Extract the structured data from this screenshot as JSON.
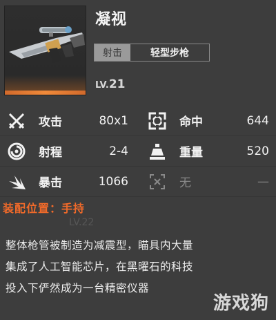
{
  "weapon": {
    "name": "凝视",
    "category": "射击",
    "subtype": "轻型步枪",
    "level_prefix": "LV.",
    "level": "21"
  },
  "stats": [
    {
      "icon": "crossed-swords-icon",
      "label": "攻击",
      "value": "80x1"
    },
    {
      "icon": "target-reticle-icon",
      "label": "命中",
      "value": "644"
    },
    {
      "icon": "range-spiral-icon",
      "label": "射程",
      "value": "2-4"
    },
    {
      "icon": "weight-icon",
      "label": "重量",
      "value": "520"
    },
    {
      "icon": "critical-burst-icon",
      "label": "暴击",
      "value": "1066"
    },
    {
      "icon": "none-icon",
      "label": "无",
      "value": "—"
    }
  ],
  "assembly": "装配位置：手持",
  "ghost_level": "LV.22",
  "description_lines": [
    "整体枪管被制造为减震型，瞄具内大量",
    "集成了人工智能芯片，在黑曜石的科技",
    "投入下俨然成为一台精密仪器"
  ],
  "watermark": "游戏狗",
  "colors": {
    "accent": "#f06a2a",
    "panel": "#3d3d3d",
    "tag": "#9a9a9a"
  }
}
